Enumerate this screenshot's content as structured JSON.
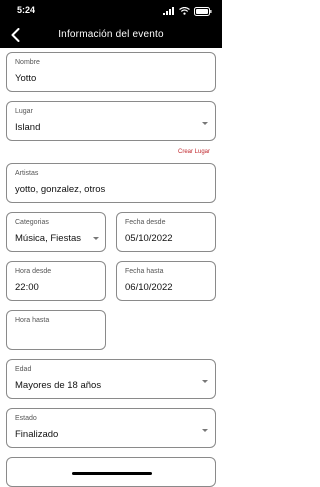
{
  "status_bar": {
    "time": "5:24"
  },
  "header": {
    "title": "Información del evento"
  },
  "form": {
    "nombre": {
      "label": "Nombre",
      "value": "Yotto"
    },
    "lugar": {
      "label": "Lugar",
      "value": "Island"
    },
    "crear_lugar": "Crear Lugar",
    "artistas": {
      "label": "Artistas",
      "value": "yotto, gonzalez, otros"
    },
    "categorias": {
      "label": "Categorias",
      "value": "Música, Fiestas"
    },
    "fecha_desde": {
      "label": "Fecha desde",
      "value": "05/10/2022"
    },
    "hora_desde": {
      "label": "Hora desde",
      "value": "22:00"
    },
    "fecha_hasta": {
      "label": "Fecha hasta",
      "value": "06/10/2022"
    },
    "hora_hasta": {
      "label": "Hora hasta",
      "value": ""
    },
    "edad": {
      "label": "Edad",
      "value": "Mayores de 18 años"
    },
    "estado": {
      "label": "Estado",
      "value": "Finalizado"
    }
  },
  "icons": {
    "back": "chevron-left-icon",
    "signal": "signal-icon",
    "wifi": "wifi-icon",
    "battery": "battery-icon",
    "dropdown": "chevron-down-icon"
  },
  "colors": {
    "header_bg": "#000000",
    "link_red": "#c0272d",
    "field_border": "#8a8a8a"
  }
}
